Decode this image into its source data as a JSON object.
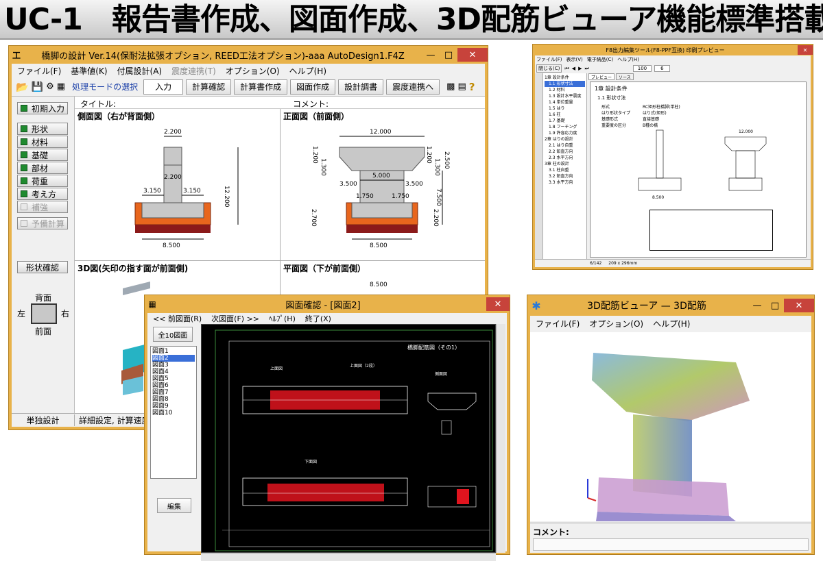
{
  "banner": {
    "title": "UC-1　報告書作成、図面作成、3D配筋ビューア機能標準搭載"
  },
  "main_window": {
    "title": "橋脚の設計 Ver.14(保耐法拡張オプション, REED工法オプション)-aaa AutoDesign1.F4Z",
    "menu": [
      "ファイル(F)",
      "基準値(K)",
      "付属設計(A)",
      "震度連携(T)",
      "オプション(O)",
      "ヘルプ(H)"
    ],
    "mode_label": "処理モードの選択",
    "tabs": [
      "入力",
      "計算確認",
      "計算書作成",
      "図面作成",
      "設計調書",
      "震度連携へ"
    ],
    "title_label": "タイトル:",
    "comment_label": "コメント:",
    "sidebar": {
      "initial": "初期入力",
      "items": [
        "形状",
        "材料",
        "基礎",
        "部材",
        "荷重",
        "考え方",
        "補強",
        "予備計算"
      ],
      "shape_check": "形状確認",
      "orient": {
        "back": "背面",
        "front": "前面",
        "left": "左",
        "right": "右"
      }
    },
    "panels": {
      "side": "側面図（右が背面側）",
      "front": "正面図（前面側）",
      "view3d": "3D図(矢印の指す面が前面側)",
      "plan": "平面図（下が前面側）"
    },
    "side_dims": {
      "top": "2.200",
      "mid": "2.200",
      "left": "3.150",
      "right": "3.150",
      "height": "12.200",
      "bottom": "8.500"
    },
    "front_dims": {
      "top": "12.000",
      "h1": "1.200",
      "h2": "1.300",
      "h3": "1.200",
      "h4": "1.300",
      "h5": "2.500",
      "col": "5.000",
      "l1": "3.500",
      "r1": "3.500",
      "l2": "1.750",
      "r2": "1.750",
      "height": "7.500",
      "foot_l": "2.700",
      "foot_r": "2.200",
      "bottom": "8.500",
      "plan_w": "8.500"
    },
    "status": {
      "mode": "単独設計",
      "info": "詳細設定, 計算速度："
    }
  },
  "preview_window": {
    "title": "F8出力編集ツール(F8-PPF互換) 印刷プレビュー",
    "menu": [
      "ファイル(F)",
      "表示(V)",
      "電子納品(C)",
      "ヘルプ(H)"
    ],
    "close_btn": "閉じる(C)",
    "tabs": [
      "プレビュー",
      "ソース"
    ],
    "zoom": "100",
    "page": "6",
    "tree": [
      "1章 設計条件",
      "1.1 形状寸法",
      "1.2 材料",
      "1.3 設計水平震度",
      "1.4 単位重量",
      "1.5 はり",
      "1.6 柱",
      "1.7 基礎",
      "1.8 フーチング",
      "1.9 許容応力度",
      "2章 はりの設計",
      "2.1 はり自重",
      "2.2 鉛直方向",
      "2.3 水平方向",
      "3章 柱の設計",
      "3.1 柱自重",
      "3.2 鉛直方向",
      "3.3 水平方向"
    ],
    "doc": {
      "chapter": "1章 設計条件",
      "section": "1.1 形状寸法",
      "rows": [
        [
          "形式",
          "RC矩形柱橋脚(単柱)"
        ],
        [
          "はり形状タイプ",
          "はり式(矩形)"
        ],
        [
          "基礎形式",
          "直接基礎"
        ],
        [
          "重要度の区分",
          "B種の橋"
        ]
      ],
      "dim_top": "12.000",
      "dim_w": "8.500"
    },
    "status": {
      "page": "6/142",
      "size": "209 x 296mm"
    }
  },
  "drawing_window": {
    "title": "図面確認 - [図面2]",
    "menu": [
      "<< 前図面(R)",
      "次図面(F) >>",
      "ﾍﾙﾌﾟ(H)",
      "終了(X)"
    ],
    "all_btn": "全10図面",
    "list": [
      "図面1",
      "図面2",
      "図面3",
      "図面4",
      "図面5",
      "図面6",
      "図面7",
      "図面8",
      "図面9",
      "図面10"
    ],
    "edit_btn": "編集",
    "drawing_title": "橋脚配筋図（その1）",
    "sec_a": "上面図",
    "sec_b": "上面図（2段）",
    "sec_c": "下面図",
    "sec_d": "側面図"
  },
  "viewer_window": {
    "title": "3D配筋ビューア — 3D配筋",
    "menu": [
      "ファイル(F)",
      "オプション(O)",
      "ヘルプ(H)"
    ],
    "comment_label": "コメント:"
  },
  "colors": {
    "frame": "#e8b24a",
    "close": "#c7433b",
    "banner": "#d0d0d0",
    "rebar": "#e0141e",
    "footing": "#e8661d"
  }
}
